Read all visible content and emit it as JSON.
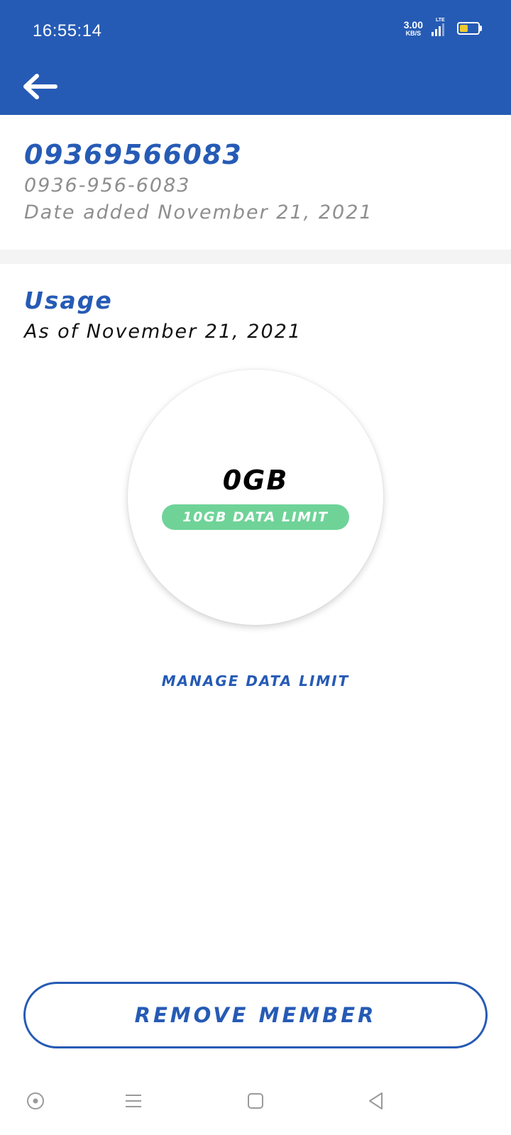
{
  "status_bar": {
    "time": "16:55:14",
    "net_speed_value": "3.00",
    "net_speed_unit": "KB/S",
    "network_type": "LTE",
    "battery_color": "#f0c930"
  },
  "app_bar": {
    "back_icon": "arrow-left-icon",
    "color": "#265bb5"
  },
  "member": {
    "number": "09369566083",
    "formatted": "0936-956-6083",
    "date_added": "Date added November 21, 2021"
  },
  "usage": {
    "title": "Usage",
    "as_of": "As of November 21, 2021",
    "amount": "0GB",
    "limit_label": "10GB DATA LIMIT",
    "used_fraction": 0,
    "pill_color": "#6fd398"
  },
  "manage_link": "MANAGE DATA LIMIT",
  "remove_button": "REMOVE MEMBER",
  "nav_bar": {
    "icons": [
      "record-icon",
      "menu-icon",
      "home-square-icon",
      "back-triangle-icon"
    ]
  }
}
